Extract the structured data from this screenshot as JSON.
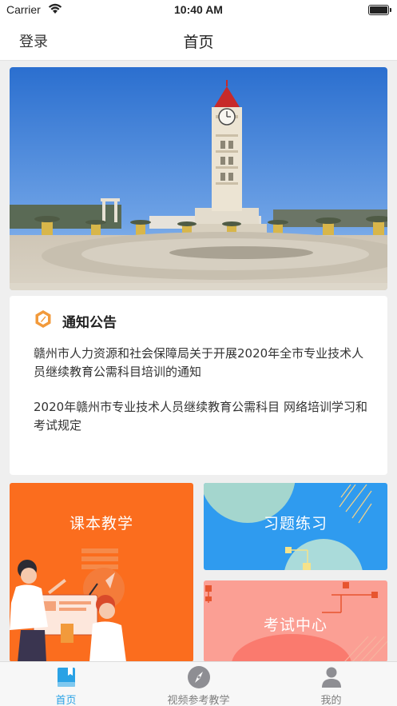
{
  "status_bar": {
    "carrier": "Carrier",
    "time": "10:40 AM"
  },
  "nav": {
    "login_label": "登录",
    "title": "首页"
  },
  "notice": {
    "title": "通知公告",
    "items": [
      "赣州市人力资源和社会保障局关于开展2020年全市专业技术人员继续教育公需科目培训的通知",
      "2020年赣州市专业技术人员继续教育公需科目  网络培训学习和考试规定"
    ]
  },
  "tiles": {
    "textbook": {
      "label": "课本教学",
      "color": "#fb6d1e"
    },
    "exercise": {
      "label": "习题练习",
      "color": "#2f9bef"
    },
    "exam": {
      "label": "考试中心",
      "color": "#fb9f94"
    }
  },
  "tabbar": {
    "active_color": "#2aa2e5",
    "items": [
      {
        "label": "首页",
        "icon": "book-icon",
        "active": true
      },
      {
        "label": "视频参考教学",
        "icon": "compass-icon",
        "active": false
      },
      {
        "label": "我的",
        "icon": "person-icon",
        "active": false
      }
    ]
  }
}
